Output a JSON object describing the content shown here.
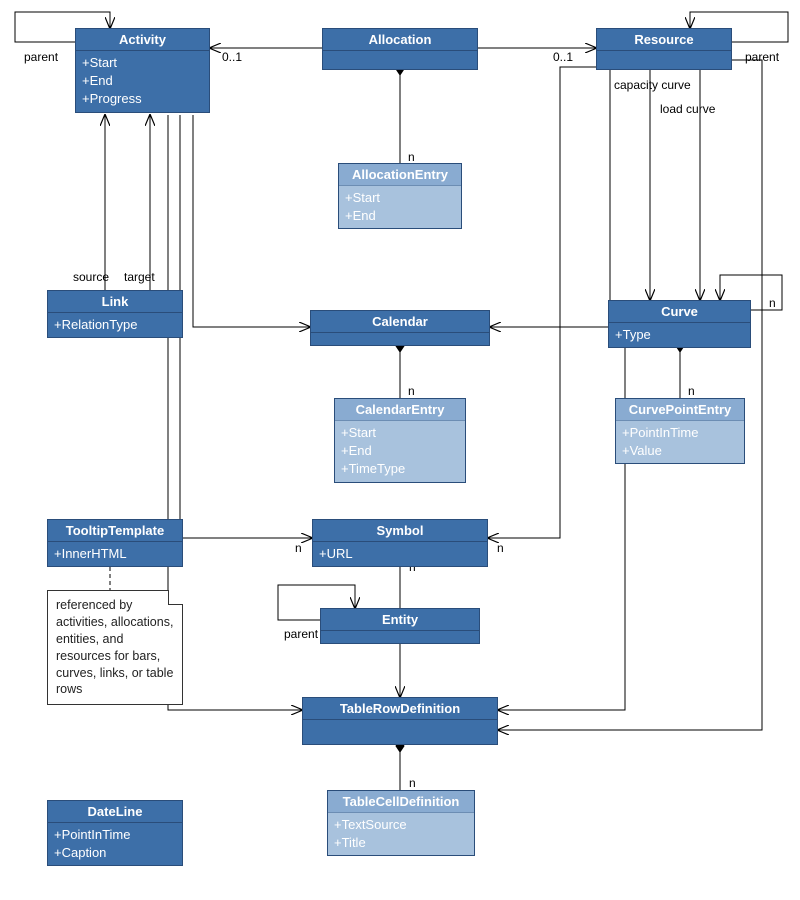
{
  "classes": {
    "activity": {
      "name": "Activity",
      "attrs": [
        "+Start",
        "+End",
        "+Progress"
      ]
    },
    "allocation": {
      "name": "Allocation"
    },
    "resource": {
      "name": "Resource"
    },
    "allocationEntry": {
      "name": "AllocationEntry",
      "attrs": [
        "+Start",
        "+End"
      ]
    },
    "link": {
      "name": "Link",
      "attrs": [
        "+RelationType"
      ]
    },
    "calendar": {
      "name": "Calendar"
    },
    "calendarEntry": {
      "name": "CalendarEntry",
      "attrs": [
        "+Start",
        "+End",
        "+TimeType"
      ]
    },
    "curve": {
      "name": "Curve",
      "attrs": [
        "+Type"
      ]
    },
    "curvePointEntry": {
      "name": "CurvePointEntry",
      "attrs": [
        "+PointInTime",
        "+Value"
      ]
    },
    "tooltipTemplate": {
      "name": "TooltipTemplate",
      "attrs": [
        "+InnerHTML"
      ]
    },
    "symbol": {
      "name": "Symbol",
      "attrs": [
        "+URL"
      ]
    },
    "entity": {
      "name": "Entity"
    },
    "tableRowDef": {
      "name": "TableRowDefinition"
    },
    "tableCellDef": {
      "name": "TableCellDefinition",
      "attrs": [
        "+TextSource",
        "+Title"
      ]
    },
    "dateLine": {
      "name": "DateLine",
      "attrs": [
        "+PointInTime",
        "+Caption"
      ]
    }
  },
  "labels": {
    "parent": "parent",
    "source": "source",
    "target": "target",
    "capacityCurve": "capacity curve",
    "loadCurve": "load curve",
    "n": "n",
    "zeroOne": "0..1"
  },
  "note": "referenced by activities, allocations, entities, and resources for bars, curves, links, or table rows"
}
